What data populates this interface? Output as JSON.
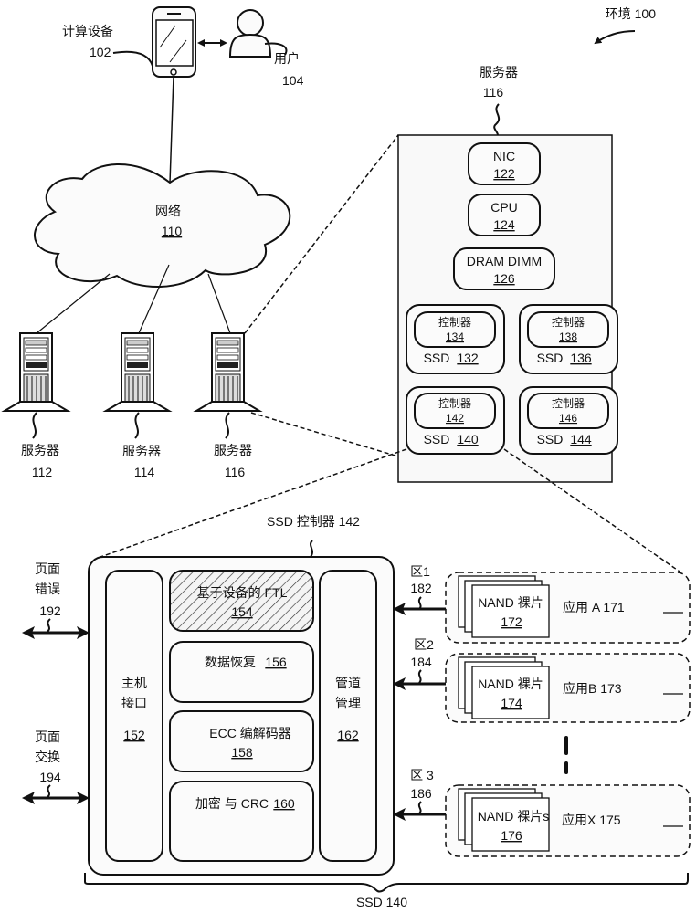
{
  "environment": {
    "label": "环境 100"
  },
  "computing_device": {
    "label": "计算设备",
    "ref": "102"
  },
  "user": {
    "label": "用户",
    "ref": "104"
  },
  "network": {
    "label": "网络",
    "ref": "110"
  },
  "servers": [
    {
      "label": "服务器",
      "ref": "112"
    },
    {
      "label": "服务器",
      "ref": "114"
    },
    {
      "label": "服务器",
      "ref": "116"
    }
  ],
  "server_detail": {
    "title": "服务器",
    "ref": "116",
    "nic": {
      "label": "NIC",
      "ref": "122"
    },
    "cpu": {
      "label": "CPU",
      "ref": "124"
    },
    "dram": {
      "label": "DRAM DIMM",
      "ref": "126"
    },
    "ssds": [
      {
        "ctrl_label": "控制器",
        "ctrl_ref": "134",
        "label": "SSD",
        "ref": "132"
      },
      {
        "ctrl_label": "控制器",
        "ctrl_ref": "138",
        "label": "SSD",
        "ref": "136"
      },
      {
        "ctrl_label": "控制器",
        "ctrl_ref": "142",
        "label": "SSD",
        "ref": "140"
      },
      {
        "ctrl_label": "控制器",
        "ctrl_ref": "146",
        "label": "SSD",
        "ref": "144"
      }
    ]
  },
  "ssd_controller": {
    "title": "SSD 控制器 142",
    "host_interface": {
      "line1": "主机",
      "line2": "接口",
      "ref": "152"
    },
    "ftl": {
      "label": "基于设备的 FTL",
      "ref": "154"
    },
    "data_recovery": {
      "label": "数据恢复",
      "ref": "156"
    },
    "ecc": {
      "label": "ECC 编解码器",
      "ref": "158"
    },
    "crypto": {
      "label": "加密 与 CRC",
      "ref": "160"
    },
    "channel_mgmt": {
      "line1": "管道",
      "line2": "管理",
      "ref": "162"
    }
  },
  "page_error": {
    "line1": "页面",
    "line2": "错误",
    "ref": "192"
  },
  "page_swap": {
    "line1": "页面",
    "line2": "交换",
    "ref": "194"
  },
  "zones": [
    {
      "zone": "区1",
      "ref": "182",
      "nand": "NAND 裸片",
      "nand_ref": "172",
      "app": "应用 A 171"
    },
    {
      "zone": "区2",
      "ref": "184",
      "nand": "NAND 裸片",
      "nand_ref": "174",
      "app": "应用B 173"
    },
    {
      "zone": "区 3",
      "ref": "186",
      "nand": "NAND 裸片s",
      "nand_ref": "176",
      "app": "应用X 175"
    }
  ],
  "ssd_bracket": {
    "label": "SSD 140"
  }
}
